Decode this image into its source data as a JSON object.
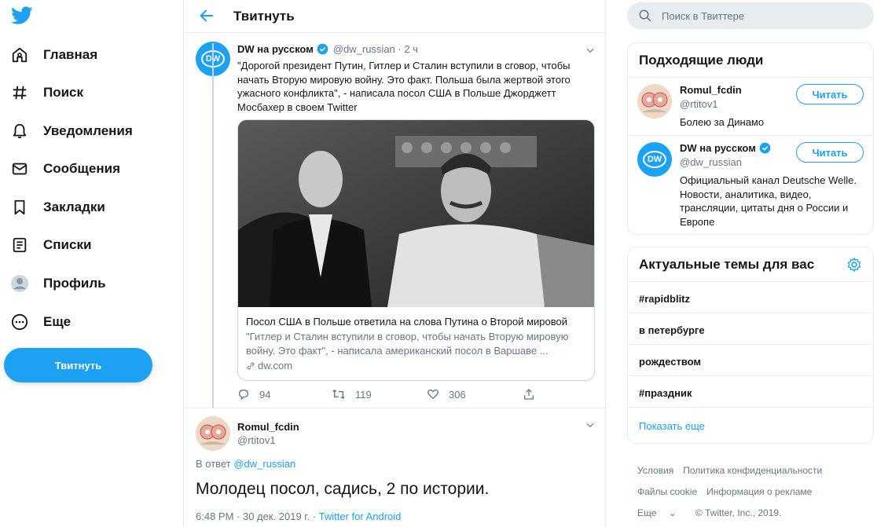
{
  "nav": {
    "items": [
      {
        "label": "Главная",
        "icon": "home-icon"
      },
      {
        "label": "Поиск",
        "icon": "hashtag-icon"
      },
      {
        "label": "Уведомления",
        "icon": "bell-icon"
      },
      {
        "label": "Сообщения",
        "icon": "envelope-icon"
      },
      {
        "label": "Закладки",
        "icon": "bookmark-icon"
      },
      {
        "label": "Списки",
        "icon": "list-icon"
      },
      {
        "label": "Профиль",
        "icon": "profile-icon"
      },
      {
        "label": "Еще",
        "icon": "more-icon"
      }
    ],
    "tweet_button": "Твитнуть"
  },
  "header": {
    "title": "Твитнуть"
  },
  "tweet": {
    "name": "DW на русском",
    "handle": "@dw_russian · 2 ч",
    "avatar_text": "DW",
    "text": "\"Дорогой президент Путин, Гитлер и Сталин вступили в сговор, чтобы начать Вторую мировую войну. Это факт. Польша была жертвой этого ужасного конфликта\", - написала посол США в Польше Джорджетт Мосбахер в своем Twitter",
    "card": {
      "title": "Посол США в Польше ответила на слова Путина о Второй мировой",
      "description": "\"Гитлер и Сталин вступили в сговор, чтобы начать Вторую мировую войну. Это факт\", - написала американский посол в Варшаве ...",
      "link": "dw.com"
    },
    "actions": {
      "replies": "94",
      "retweets": "119",
      "likes": "306"
    }
  },
  "reply": {
    "name": "Romul_fcdin",
    "handle": "@rtitov1",
    "reply_to_prefix": "В ответ",
    "reply_to_handle": "@dw_russian",
    "text": "Молодец посол, садись, 2 по истории.",
    "timestamp": "6:48 PM · 30 дек. 2019 г. · ",
    "source": "Twitter for Android"
  },
  "search": {
    "placeholder": "Поиск в Твиттере"
  },
  "who_to_follow": {
    "title": "Подходящие люди",
    "users": [
      {
        "name": "Romul_fcdin",
        "handle": "@rtitov1",
        "bio": "Болею за Динамо",
        "button": "Читать"
      },
      {
        "name": "DW на русском",
        "handle": "@dw_russian",
        "bio": "Официальный канал Deutsche Welle. Новости, аналитика, видео, трансляции, цитаты дня о России и Европе",
        "button": "Читать",
        "avatar_text": "DW"
      }
    ]
  },
  "trends": {
    "title": "Актуальные темы для вас",
    "items": [
      "#rapidblitz",
      "в петербурге",
      "рождеством",
      "#праздник"
    ],
    "show_more": "Показать еще"
  },
  "footer": {
    "row1": [
      "Условия",
      "Политика конфиденциальности"
    ],
    "row2": [
      "Файлы cookie",
      "Информация о рекламе"
    ],
    "more": "Еще",
    "copyright": "© Twitter, Inc., 2019."
  },
  "colors": {
    "accent": "#1da1f2",
    "secondary_text": "#657786",
    "border": "#e6ecf0"
  }
}
